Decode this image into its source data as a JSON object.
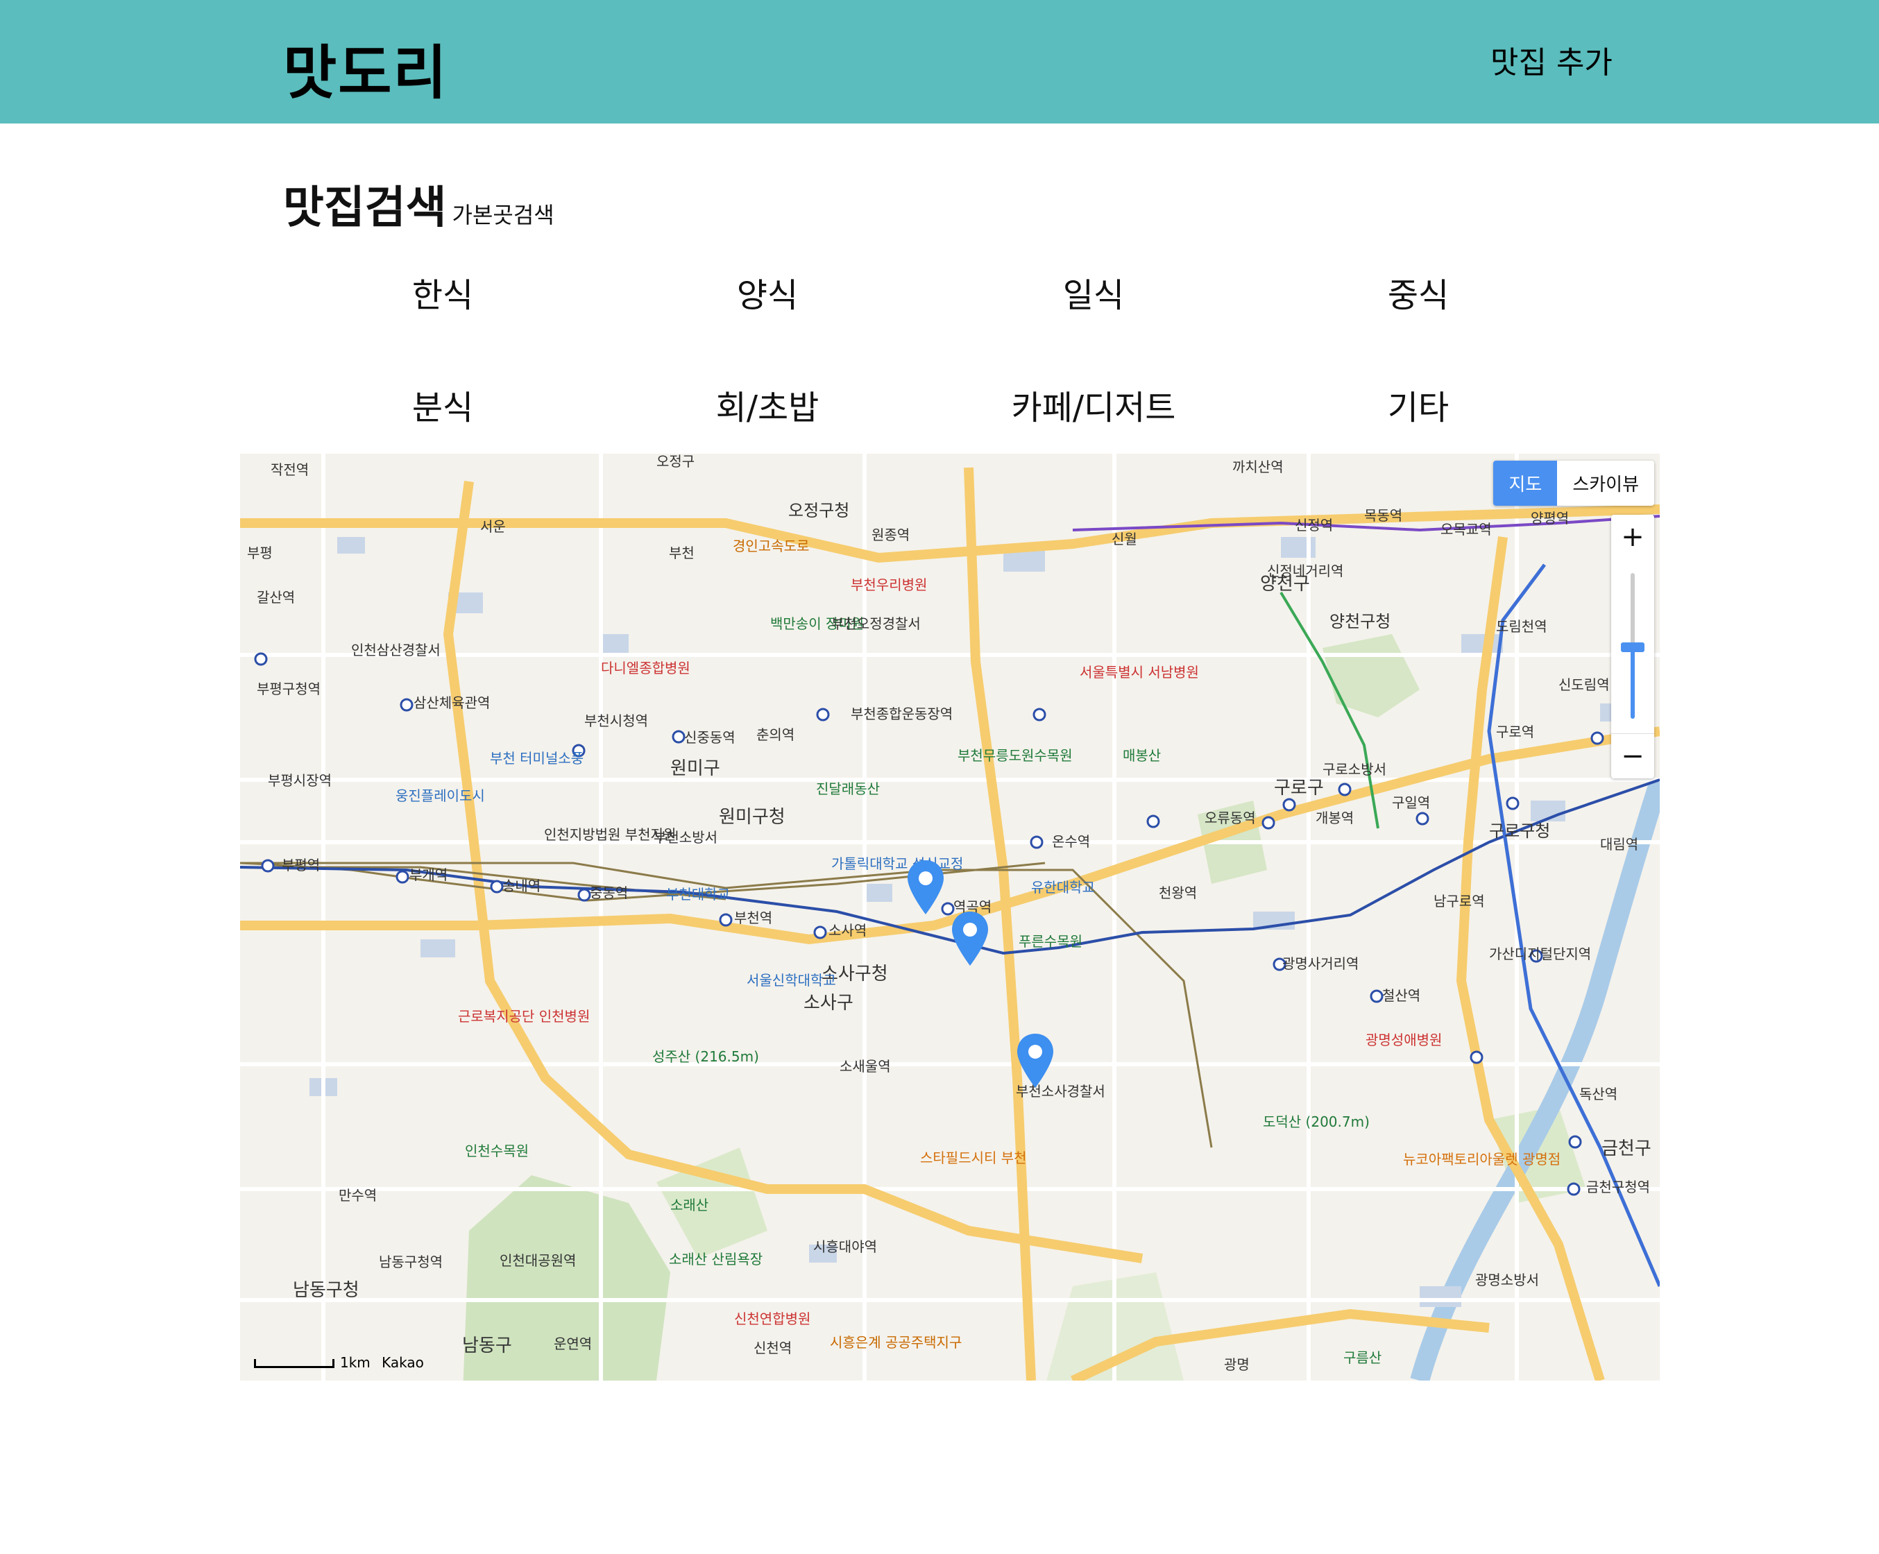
{
  "header": {
    "logo": "맛도리",
    "add_label": "맛집 추가"
  },
  "search": {
    "title": "맛집검색",
    "subtitle": "가본곳검색"
  },
  "categories": [
    "한식",
    "양식",
    "일식",
    "중식",
    "분식",
    "회/초밥",
    "카페/디저트",
    "기타"
  ],
  "map": {
    "map_type_label": "지도",
    "skyview_label": "스카이뷰",
    "zoom_in_label": "+",
    "zoom_out_label": "−",
    "scale_label": "1km",
    "provider": "Kakao",
    "pin_color": "#3d8ff0",
    "labels": [
      "오정구",
      "오정구청",
      "원종역",
      "경인고속도로",
      "부천우리병원",
      "까치산역",
      "신정역",
      "목동역",
      "오목교역",
      "양평역",
      "양천구",
      "양천구청",
      "신정네거리역",
      "도림천역",
      "신도림역",
      "구로역",
      "구로구",
      "구로구청",
      "대림역",
      "구일역",
      "개봉역",
      "오류동역",
      "온수역",
      "부천종합운동장역",
      "춘의역",
      "신중동역",
      "부천시청역",
      "삼산체육관역",
      "부평구청역",
      "부평역",
      "부개역",
      "송내역",
      "중동역",
      "부천역",
      "소사역",
      "역곡역",
      "원미구",
      "원미구청",
      "소사구청",
      "소사구",
      "부천대학교",
      "가톨릭대학교 성심교정",
      "유한대학교",
      "서울신학대학교",
      "푸른수목원",
      "부천무릉도원수목원",
      "매봉산",
      "천왕역",
      "광명사거리역",
      "철산역",
      "광명성애병원",
      "가산디지털단지역",
      "남구로역",
      "독산역",
      "금천구청역",
      "금천구",
      "도덕산 (200.7m)",
      "뉴코아팩토리아울렛 광명점",
      "스타필드시티 부천",
      "부천소사경찰서",
      "소새울역",
      "성주산 (216.5m)",
      "근로복지공단 인천병원",
      "인천수목원",
      "만수역",
      "남동구청역",
      "인천대공원역",
      "남동구청",
      "남동구",
      "운연역",
      "신천역",
      "시흥대야역",
      "소래산",
      "소래산 산림욕장",
      "신천연합병원",
      "시흥은계 공공주택지구",
      "광명",
      "구름산",
      "광명소방서",
      "인천삼산경찰서",
      "다니엘종합병원",
      "부천 터미널소풍",
      "웅진플레이도시",
      "인천지방법원 부천지원",
      "부천소방서",
      "진달래동산",
      "백만송이 장미원",
      "부천오정경찰서",
      "서울특별시 서남병원",
      "구로소방서",
      "갈산역",
      "부평시장역",
      "작전역",
      "서운",
      "부천",
      "신월",
      "부평"
    ]
  }
}
